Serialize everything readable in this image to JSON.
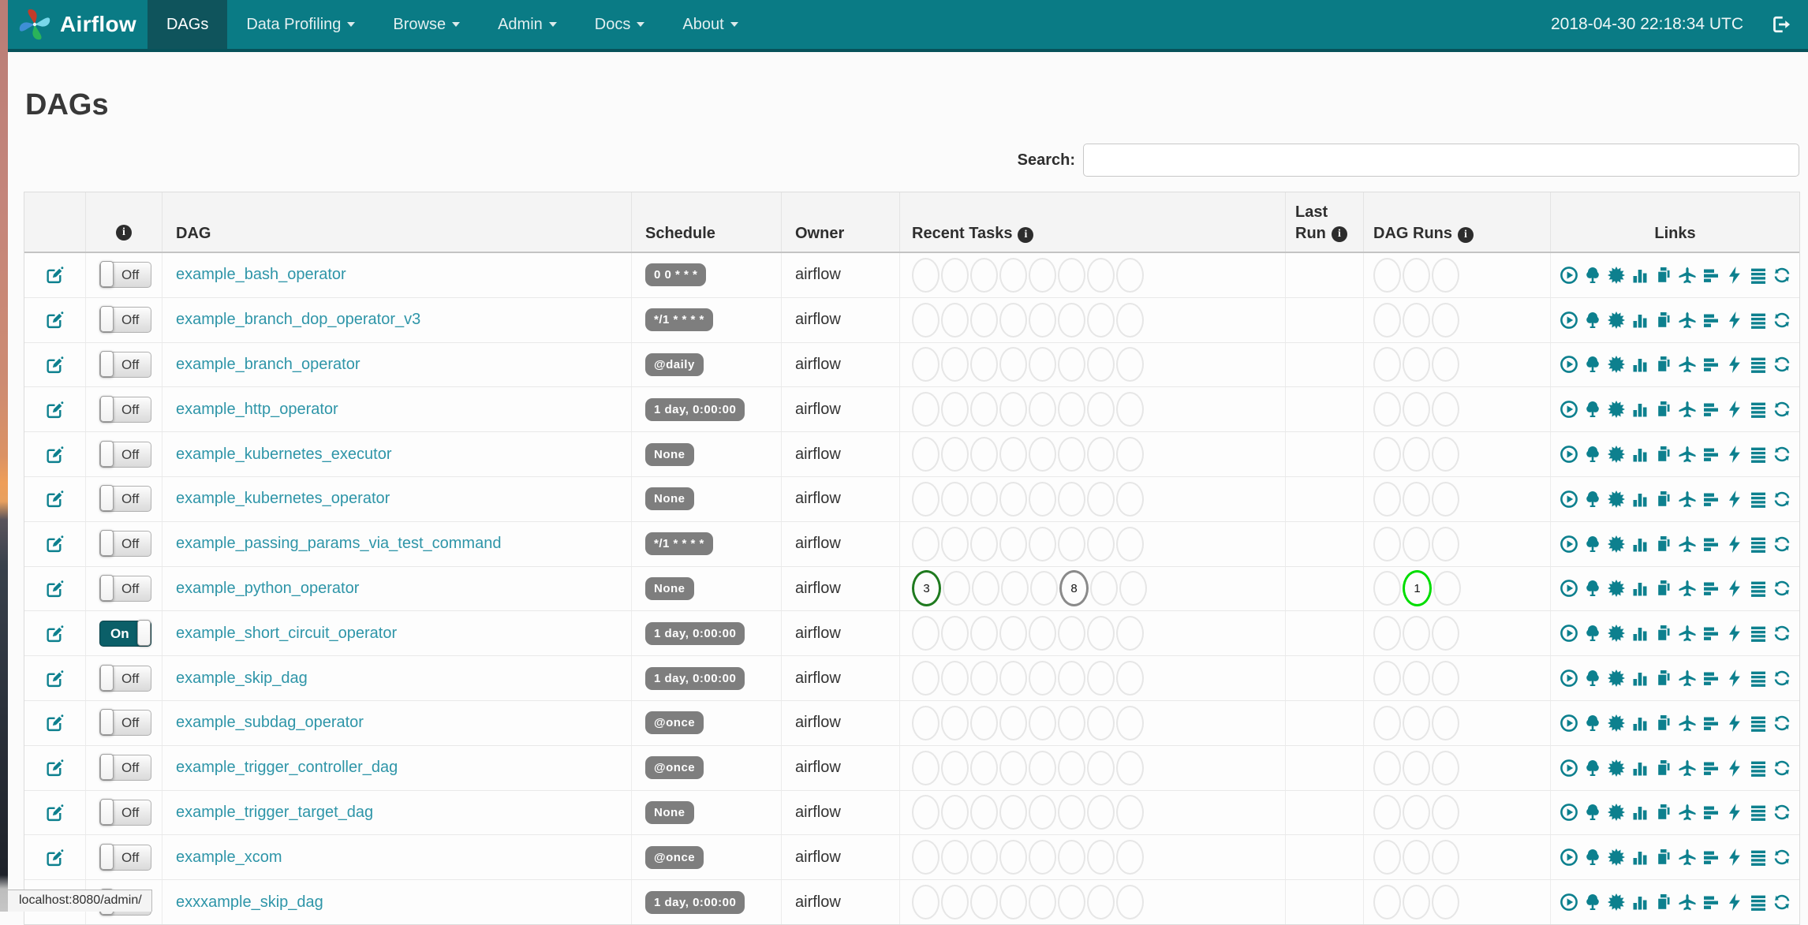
{
  "colors": {
    "navbar_bg": "#0a7b85",
    "navbar_active_bg": "#0f545c",
    "link": "#2e95a8",
    "icon_teal": "#0d808e",
    "badge_bg": "#7e7e7e",
    "toggle_on_bg": "#0b5f68",
    "state_success": "#1f7a1f",
    "state_queued": "#8a8a8a",
    "state_running": "#00dd00"
  },
  "navbar": {
    "brand": "Airflow",
    "items": [
      {
        "label": "DAGs",
        "active": true,
        "dropdown": false
      },
      {
        "label": "Data Profiling",
        "active": false,
        "dropdown": true
      },
      {
        "label": "Browse",
        "active": false,
        "dropdown": true
      },
      {
        "label": "Admin",
        "active": false,
        "dropdown": true
      },
      {
        "label": "Docs",
        "active": false,
        "dropdown": true
      },
      {
        "label": "About",
        "active": false,
        "dropdown": true
      }
    ],
    "clock": "2018-04-30 22:18:34 UTC"
  },
  "page": {
    "title": "DAGs",
    "search_label": "Search:",
    "search_value": ""
  },
  "table": {
    "headers": {
      "dag": "DAG",
      "schedule": "Schedule",
      "owner": "Owner",
      "recent_tasks": "Recent Tasks",
      "last_run_line1": "Last",
      "last_run_line2": "Run",
      "dag_runs": "DAG Runs",
      "links": "Links"
    },
    "recent_tasks_circles": 8,
    "dag_runs_circles": 3,
    "link_icons": [
      "trigger-dag",
      "tree-view",
      "graph-view",
      "task-duration",
      "task-tries",
      "landing-times",
      "gantt",
      "code-view",
      "logs",
      "refresh"
    ],
    "rows": [
      {
        "dag": "example_bash_operator",
        "toggle": "Off",
        "schedule": "0 0 * * *",
        "owner": "airflow",
        "last_run": "",
        "recent_tasks": [],
        "dag_runs": []
      },
      {
        "dag": "example_branch_dop_operator_v3",
        "toggle": "Off",
        "schedule": "*/1 * * * *",
        "owner": "airflow",
        "last_run": "",
        "recent_tasks": [],
        "dag_runs": []
      },
      {
        "dag": "example_branch_operator",
        "toggle": "Off",
        "schedule": "@daily",
        "owner": "airflow",
        "last_run": "",
        "recent_tasks": [],
        "dag_runs": []
      },
      {
        "dag": "example_http_operator",
        "toggle": "Off",
        "schedule": "1 day, 0:00:00",
        "owner": "airflow",
        "last_run": "",
        "recent_tasks": [],
        "dag_runs": []
      },
      {
        "dag": "example_kubernetes_executor",
        "toggle": "Off",
        "schedule": "None",
        "owner": "airflow",
        "last_run": "",
        "recent_tasks": [],
        "dag_runs": []
      },
      {
        "dag": "example_kubernetes_operator",
        "toggle": "Off",
        "schedule": "None",
        "owner": "airflow",
        "last_run": "",
        "recent_tasks": [],
        "dag_runs": []
      },
      {
        "dag": "example_passing_params_via_test_command",
        "toggle": "Off",
        "schedule": "*/1 * * * *",
        "owner": "airflow",
        "last_run": "",
        "recent_tasks": [],
        "dag_runs": []
      },
      {
        "dag": "example_python_operator",
        "toggle": "Off",
        "schedule": "None",
        "owner": "airflow",
        "last_run": "",
        "recent_tasks": [
          {
            "index": 0,
            "count": "3",
            "state": "success"
          },
          {
            "index": 5,
            "count": "8",
            "state": "queued"
          }
        ],
        "dag_runs": [
          {
            "index": 1,
            "count": "1",
            "state": "running"
          }
        ]
      },
      {
        "dag": "example_short_circuit_operator",
        "toggle": "On",
        "schedule": "1 day, 0:00:00",
        "owner": "airflow",
        "last_run": "",
        "recent_tasks": [],
        "dag_runs": []
      },
      {
        "dag": "example_skip_dag",
        "toggle": "Off",
        "schedule": "1 day, 0:00:00",
        "owner": "airflow",
        "last_run": "",
        "recent_tasks": [],
        "dag_runs": []
      },
      {
        "dag": "example_subdag_operator",
        "toggle": "Off",
        "schedule": "@once",
        "owner": "airflow",
        "last_run": "",
        "recent_tasks": [],
        "dag_runs": []
      },
      {
        "dag": "example_trigger_controller_dag",
        "toggle": "Off",
        "schedule": "@once",
        "owner": "airflow",
        "last_run": "",
        "recent_tasks": [],
        "dag_runs": []
      },
      {
        "dag": "example_trigger_target_dag",
        "toggle": "Off",
        "schedule": "None",
        "owner": "airflow",
        "last_run": "",
        "recent_tasks": [],
        "dag_runs": []
      },
      {
        "dag": "example_xcom",
        "toggle": "Off",
        "schedule": "@once",
        "owner": "airflow",
        "last_run": "",
        "recent_tasks": [],
        "dag_runs": []
      },
      {
        "dag": "exxxample_skip_dag",
        "toggle": "Off",
        "schedule": "1 day, 0:00:00",
        "owner": "airflow",
        "last_run": "",
        "recent_tasks": [],
        "dag_runs": []
      }
    ]
  },
  "status_bar": {
    "text": "localhost:8080/admin/"
  }
}
